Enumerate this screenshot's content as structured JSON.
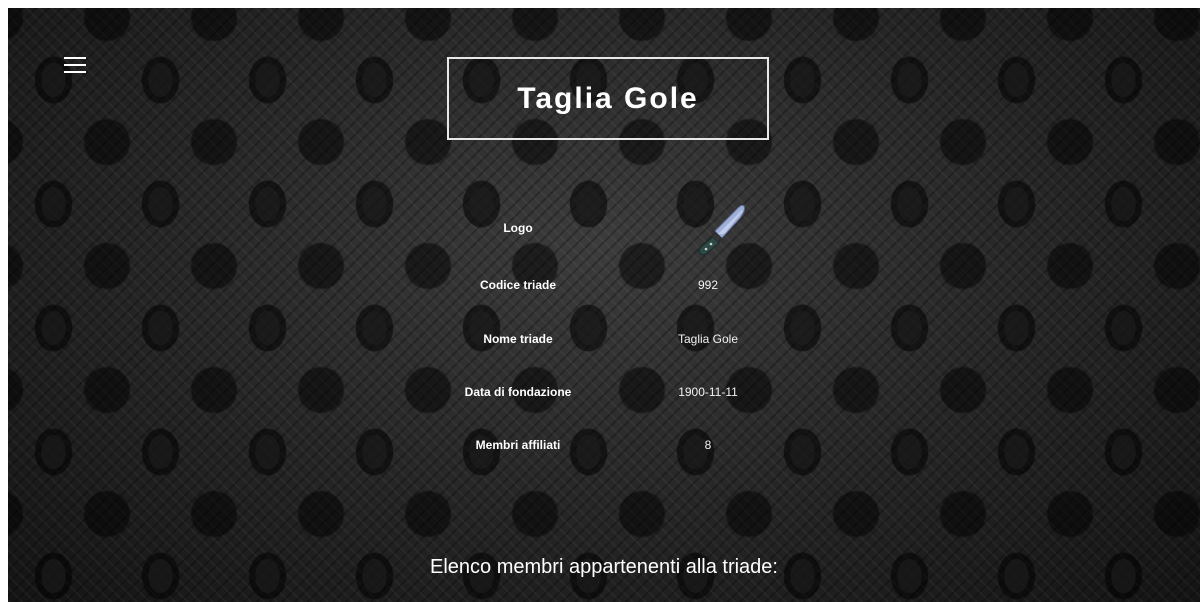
{
  "menu": {
    "icon": "hamburger-menu-icon"
  },
  "header": {
    "title": "Taglia Gole"
  },
  "details": {
    "logo_label": "Logo",
    "logo_icon": "knife-icon",
    "rows": [
      {
        "label": "Codice triade",
        "value": "992"
      },
      {
        "label": "Nome triade",
        "value": "Taglia Gole"
      },
      {
        "label": "Data di fondazione",
        "value": "1900-11-11"
      },
      {
        "label": "Membri affiliati",
        "value": "8"
      }
    ]
  },
  "members_section": {
    "heading": "Elenco membri appartenenti alla triade:"
  }
}
